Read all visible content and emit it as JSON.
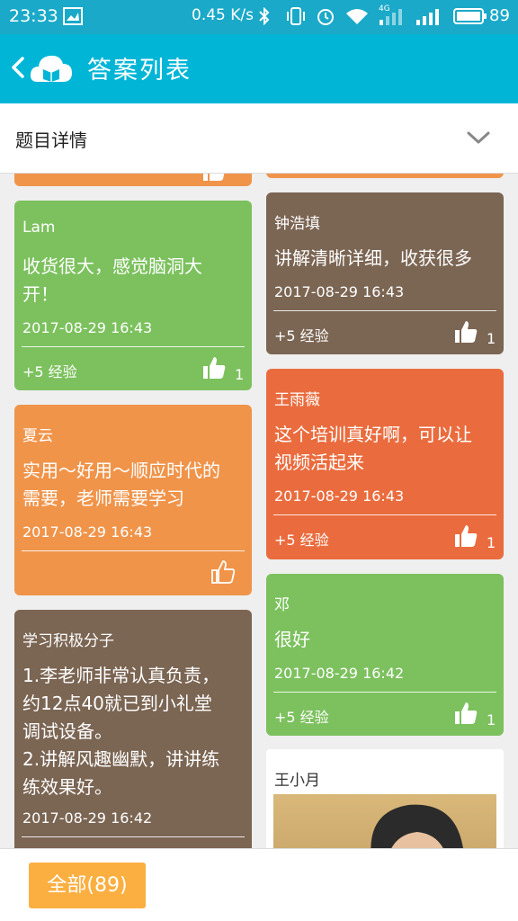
{
  "status_bar": {
    "time": "23:33",
    "rate": "0.45 K/s",
    "network": "4G",
    "battery": "89"
  },
  "app_bar": {
    "title": "答案列表"
  },
  "detail_bar": {
    "label": "题目详情"
  },
  "colors": {
    "primary": "#00b5d6",
    "green": "#7cc15e",
    "orange": "#f0944a",
    "brown": "#7b6553",
    "red": "#ea6c3e",
    "button": "#fbaf41"
  },
  "cards": {
    "lam": {
      "name": "Lam",
      "line1": "收货很大，感觉脑洞大",
      "line2": "开！",
      "date": "2017-08-29 16:43",
      "exp": "+5 经验",
      "likes": "1"
    },
    "xiayun": {
      "name": "夏云",
      "line1": "实用～好用～顺应时代的",
      "line2": "需要，老师需要学习",
      "date": "2017-08-29 16:43"
    },
    "xuexi": {
      "name": "学习积极分子",
      "line1": "1.李老师非常认真负责，",
      "line2": "约12点40就已到小礼堂",
      "line3": "调试设备。",
      "line4": "2.讲解风趣幽默，讲讲练",
      "line5": "练效果好。",
      "date": "2017-08-29 16:42"
    },
    "zhong": {
      "name": "钟浩填",
      "line1": "讲解清晰详细，收获很多",
      "date": "2017-08-29 16:43",
      "exp": "+5 经验",
      "likes": "1"
    },
    "wang": {
      "name": "王雨薇",
      "line1": "这个培训真好啊，可以让",
      "line2": "视频活起来",
      "date": "2017-08-29 16:43",
      "exp": "+5 经验",
      "likes": "1"
    },
    "deng": {
      "name": "邓",
      "line1": "很好",
      "date": "2017-08-29 16:42",
      "exp": "+5 经验",
      "likes": "1"
    },
    "wangxiaoyue": {
      "name": "王小月"
    }
  },
  "footer": {
    "all_button": "全部(89)"
  }
}
